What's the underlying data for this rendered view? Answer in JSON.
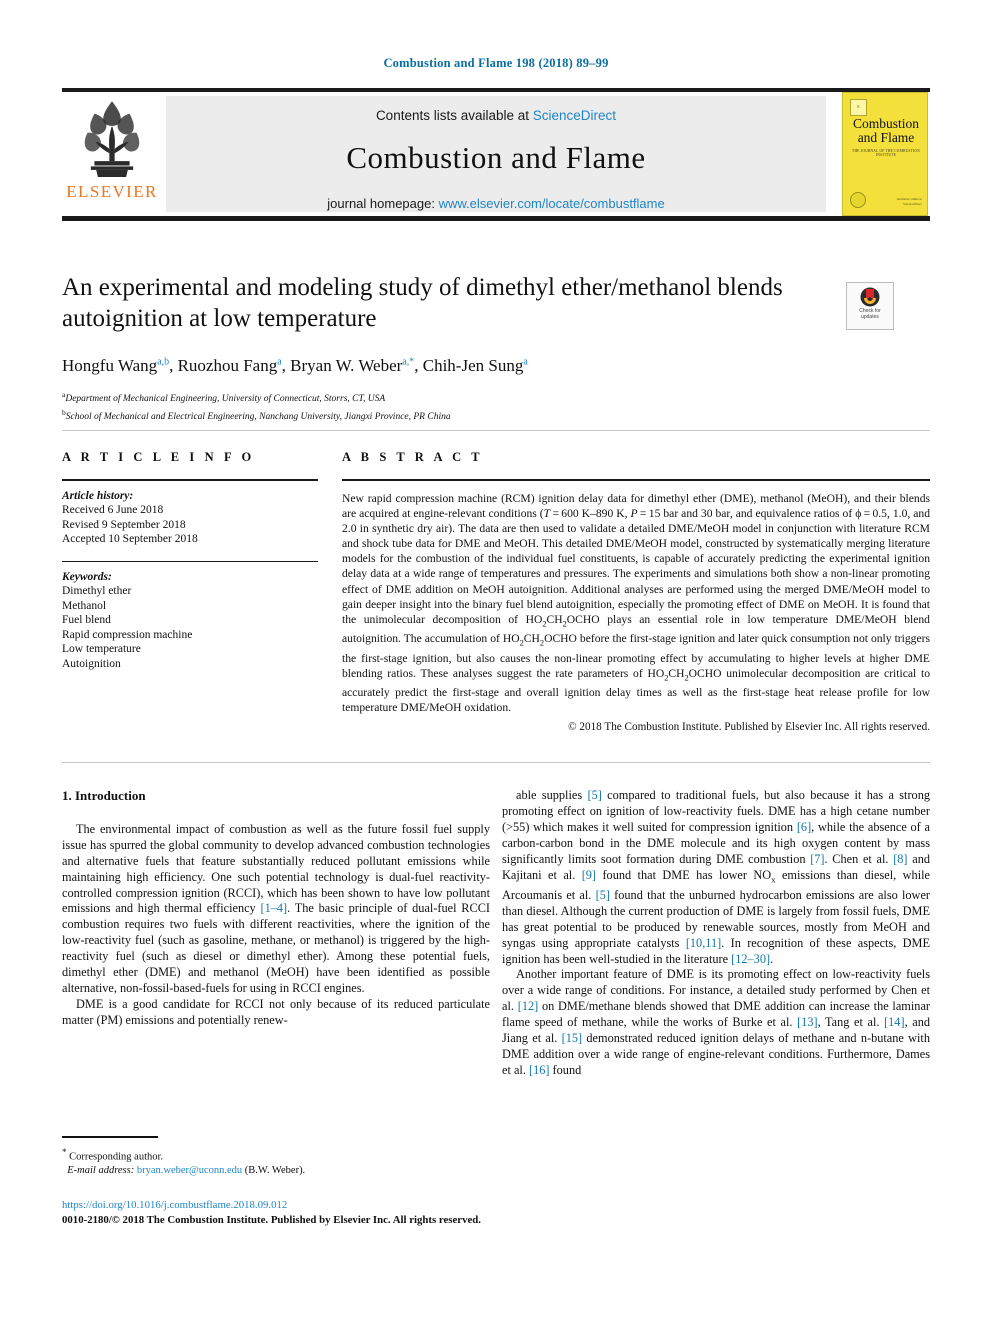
{
  "running_head": "Combustion and Flame 198 (2018) 89–99",
  "masthead": {
    "contents_prefix": "Contents lists available at ",
    "contents_link": "ScienceDirect",
    "journal_title": "Combustion and Flame",
    "homepage_prefix": "journal homepage: ",
    "homepage_link": "www.elsevier.com/locate/combustflame",
    "publisher": "ELSEVIER"
  },
  "cover": {
    "title_line1": "Combustion",
    "title_line2": "and Flame",
    "subtitle": "THE JOURNAL OF THE COMBUSTION INSTITUTE",
    "footer_line1": "Available online at",
    "footer_line2": "ScienceDirect",
    "accent_color": "#f3e03b"
  },
  "crossmark": {
    "line1": "Check for",
    "line2": "updates"
  },
  "title": "An experimental and modeling study of dimethyl ether/methanol blends autoignition at low temperature",
  "authors_html": "Hongfu Wang<sup>a,b</sup>, Ruozhou Fang<sup>a</sup>, Bryan W. Weber<sup>a,</sup><sup class=\"star\">*</sup>, Chih-Jen Sung<sup>a</sup>",
  "affiliations": [
    {
      "marker": "a",
      "text": "Department of Mechanical Engineering, University of Connecticut, Storrs, CT, USA"
    },
    {
      "marker": "b",
      "text": "School of Mechanical and Electrical Engineering, Nanchang University, Jiangxi Province, PR China"
    }
  ],
  "article_info": {
    "heading": "A R T I C L E   I N F O",
    "history_label": "Article history:",
    "history": [
      "Received 6 June 2018",
      "Revised 9 September 2018",
      "Accepted 10 September 2018"
    ],
    "keywords_label": "Keywords:",
    "keywords": [
      "Dimethyl ether",
      "Methanol",
      "Fuel blend",
      "Rapid compression machine",
      "Low temperature",
      "Autoignition"
    ]
  },
  "abstract": {
    "heading": "A B S T R A C T",
    "body_html": "New rapid compression machine (RCM) ignition delay data for dimethyl ether (DME), methanol (MeOH), and their blends are acquired at engine-relevant conditions (<i>T</i> = 600 K–890 K, <i>P</i> = 15 bar and 30 bar, and equivalence ratios of ϕ = 0.5, 1.0, and 2.0 in synthetic dry air). The data are then used to validate a detailed DME/MeOH model in conjunction with literature RCM and shock tube data for DME and MeOH. This detailed DME/MeOH model, constructed by systematically merging literature models for the combustion of the individual fuel constituents, is capable of accurately predicting the experimental ignition delay data at a wide range of temperatures and pressures. The experiments and simulations both show a non-linear promoting effect of DME addition on MeOH autoignition. Additional analyses are performed using the merged DME/MeOH model to gain deeper insight into the binary fuel blend autoignition, especially the promoting effect of DME on MeOH. It is found that the unimolecular decomposition of HO<sub>2</sub>CH<sub>2</sub>OCHO plays an essential role in low temperature DME/MeOH blend autoignition. The accumulation of HO<sub>2</sub>CH<sub>2</sub>OCHO before the first-stage ignition and later quick consumption not only triggers the first-stage ignition, but also causes the non-linear promoting effect by accumulating to higher levels at higher DME blending ratios. These analyses suggest the rate parameters of HO<sub>2</sub>CH<sub>2</sub>OCHO unimolecular decomposition are critical to accurately predict the first-stage and overall ignition delay times as well as the first-stage heat release profile for low temperature DME/MeOH oxidation.",
    "copyright": "© 2018 The Combustion Institute. Published by Elsevier Inc. All rights reserved."
  },
  "body": {
    "section_heading": "1. Introduction",
    "left_paragraphs_html": [
      "The environmental impact of combustion as well as the future fossil fuel supply issue has spurred the global community to develop advanced combustion technologies and alternative fuels that feature substantially reduced pollutant emissions while maintaining high efficiency. One such potential technology is dual-fuel reactivity-controlled compression ignition (RCCI), which has been shown to have low pollutant emissions and high thermal efficiency <span class=\"ref\">[1–4]</span>. The basic principle of dual-fuel RCCI combustion requires two fuels with different reactivities, where the ignition of the low-reactivity fuel (such as gasoline, methane, or methanol) is triggered by the high-reactivity fuel (such as diesel or dimethyl ether). Among these potential fuels, dimethyl ether (DME) and methanol (MeOH) have been identified as possible alternative, non-fossil-based-fuels for using in RCCI engines.",
      "DME is a good candidate for RCCI not only because of its reduced particulate matter (PM) emissions and potentially renew-"
    ],
    "right_paragraphs_html": [
      "able supplies <span class=\"ref\">[5]</span> compared to traditional fuels, but also because it has a strong promoting effect on ignition of low-reactivity fuels. DME has a high cetane number (&gt;55) which makes it well suited for compression ignition <span class=\"ref\">[6]</span>, while the absence of a carbon-carbon bond in the DME molecule and its high oxygen content by mass significantly limits soot formation during DME combustion <span class=\"ref\">[7]</span>. Chen et al. <span class=\"ref\">[8]</span> and Kajitani et al. <span class=\"ref\">[9]</span> found that DME has lower NO<sub>x</sub> emissions than diesel, while Arcoumanis et al. <span class=\"ref\">[5]</span> found that the unburned hydrocarbon emissions are also lower than diesel. Although the current production of DME is largely from fossil fuels, DME has great potential to be produced by renewable sources, mostly from MeOH and syngas using appropriate catalysts <span class=\"ref\">[10,11]</span>. In recognition of these aspects, DME ignition has been well-studied in the literature <span class=\"ref\">[12–30]</span>.",
      "Another important feature of DME is its promoting effect on low-reactivity fuels over a wide range of conditions. For instance, a detailed study performed by Chen et al. <span class=\"ref\">[12]</span> on DME/methane blends showed that DME addition can increase the laminar flame speed of methane, while the works of Burke et al. <span class=\"ref\">[13]</span>, Tang et al. <span class=\"ref\">[14]</span>, and Jiang et al. <span class=\"ref\">[15]</span> demonstrated reduced ignition delays of methane and n-butane with DME addition over a wide range of engine-relevant conditions. Furthermore, Dames et al. <span class=\"ref\">[16]</span> found"
    ]
  },
  "footnote": {
    "corresponding_author": "Corresponding author.",
    "email_label": "E-mail address:",
    "email": "bryan.weber@uconn.edu",
    "email_suffix": "(B.W. Weber)."
  },
  "page_footer": {
    "doi": "https://doi.org/10.1016/j.combustflame.2018.09.012",
    "issn_line": "0010-2180/© 2018 The Combustion Institute. Published by Elsevier Inc. All rights reserved."
  },
  "colors": {
    "link": "#1f86c8",
    "ref": "#1276a8",
    "running_head": "#0a6ea1",
    "elsevier_orange": "#e87722"
  }
}
